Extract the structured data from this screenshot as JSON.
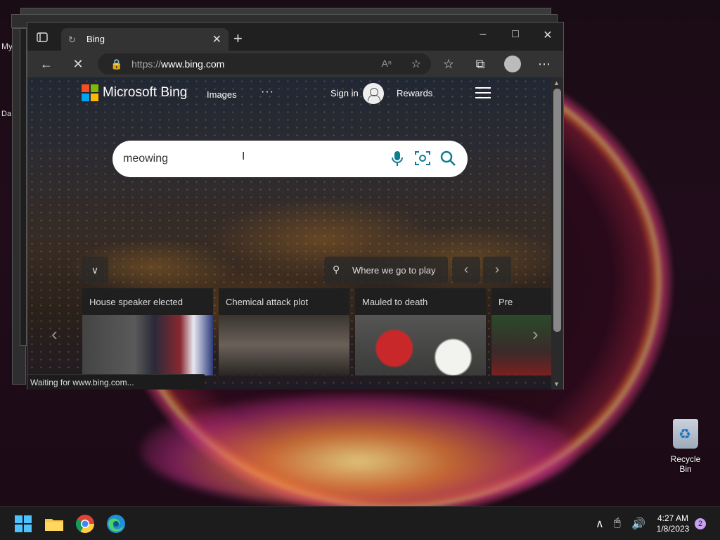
{
  "desktop": {
    "left_peek_labels": [
      "My",
      "Da"
    ],
    "recycle_bin_label": "Recycle Bin"
  },
  "browser": {
    "tab_title": "Bing",
    "url_prefix": "https://",
    "url_host": "www.bing.com",
    "status_text": "Waiting for www.bing.com..."
  },
  "bing": {
    "brand": "Microsoft Bing",
    "nav_images": "Images",
    "nav_more": "···",
    "sign_in": "Sign in",
    "rewards": "Rewards",
    "search_query": "meowing",
    "where_we_go": "Where we go to play",
    "news": [
      {
        "caption": "House speaker elected"
      },
      {
        "caption": "Chemical attack plot"
      },
      {
        "caption": "Mauled to death"
      },
      {
        "caption": "Pre"
      }
    ]
  },
  "taskbar": {
    "time": "4:27 AM",
    "date": "1/8/2023",
    "notification_count": "2"
  },
  "colors": {
    "bing_accent": "#0f7b8f",
    "edge_active_indicator": "#ff7a9a"
  }
}
